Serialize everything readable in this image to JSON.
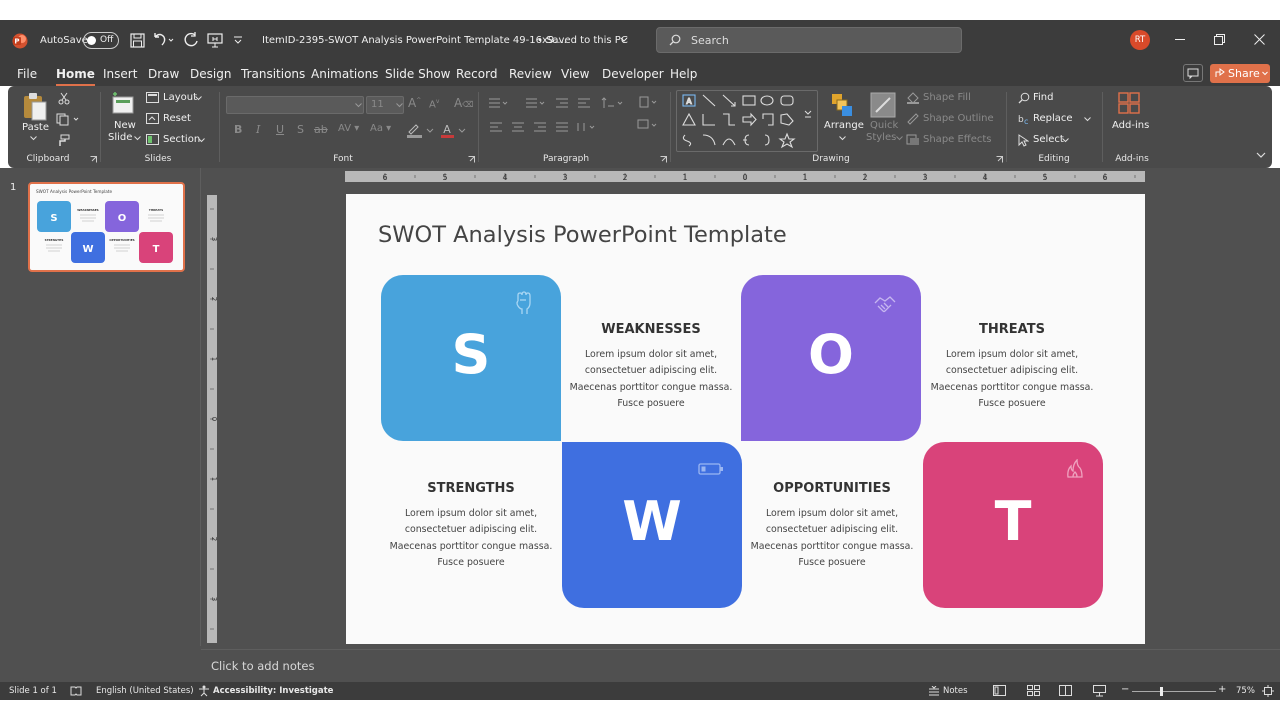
{
  "window": {
    "autosave_label": "AutoSave",
    "autosave_state": "Off",
    "file_title": "ItemID-2395-SWOT Analysis PowerPoint Template 49-16x9....",
    "save_status": "• Saved to this PC",
    "search_placeholder": "Search",
    "user_initials": "RT"
  },
  "menu": {
    "items": [
      "File",
      "Home",
      "Insert",
      "Draw",
      "Design",
      "Transitions",
      "Animations",
      "Slide Show",
      "Record",
      "Review",
      "View",
      "Developer",
      "Help"
    ],
    "active": "Home",
    "share_label": "Share"
  },
  "ribbon": {
    "clipboard": {
      "paste": "Paste",
      "group": "Clipboard"
    },
    "slides": {
      "new_slide_1": "New",
      "new_slide_2": "Slide",
      "layout": "Layout",
      "reset": "Reset",
      "section": "Section",
      "group": "Slides"
    },
    "font": {
      "size": "11",
      "group": "Font"
    },
    "paragraph": {
      "group": "Paragraph"
    },
    "drawing": {
      "arrange": "Arrange",
      "quick_styles_1": "Quick",
      "quick_styles_2": "Styles",
      "shape_fill": "Shape Fill",
      "shape_outline": "Shape Outline",
      "shape_effects": "Shape Effects",
      "group": "Drawing"
    },
    "editing": {
      "find": "Find",
      "replace": "Replace",
      "select": "Select",
      "group": "Editing"
    },
    "addins": {
      "label": "Add-ins",
      "group": "Add-ins"
    }
  },
  "thumbnail": {
    "number": "1"
  },
  "slide": {
    "title": "SWOT Analysis PowerPoint Template",
    "letters": {
      "s": "S",
      "o": "O",
      "w": "W",
      "t": "T"
    },
    "sections": {
      "weaknesses": {
        "heading": "WEAKNESSES",
        "body": "Lorem ipsum dolor sit amet, consectetuer adipiscing elit. Maecenas porttitor congue massa. Fusce posuere"
      },
      "threats": {
        "heading": "THREATS",
        "body": "Lorem ipsum dolor sit amet, consectetuer adipiscing elit. Maecenas porttitor congue massa. Fusce posuere"
      },
      "strengths": {
        "heading": "STRENGTHS",
        "body": "Lorem ipsum dolor sit amet, consectetuer adipiscing elit. Maecenas porttitor congue massa. Fusce posuere"
      },
      "opportunities": {
        "heading": "OPPORTUNITIES",
        "body": "Lorem ipsum dolor sit amet, consectetuer adipiscing elit. Maecenas porttitor congue massa. Fusce posuere"
      }
    },
    "colors": {
      "s": "#48a3dc",
      "o": "#8565dc",
      "w": "#3f6fe0",
      "t": "#d9437a"
    }
  },
  "ruler": {
    "h_ticks": [
      "6",
      "5",
      "4",
      "3",
      "2",
      "1",
      "0",
      "1",
      "2",
      "3",
      "4",
      "5",
      "6"
    ],
    "v_ticks": [
      "3",
      "2",
      "1",
      "0",
      "1",
      "2",
      "3"
    ]
  },
  "notes": {
    "placeholder": "Click to add notes"
  },
  "status": {
    "slide_count": "Slide 1 of 1",
    "language": "English (United States)",
    "accessibility": "Accessibility: Investigate",
    "notes_btn": "Notes",
    "zoom": "75%"
  }
}
